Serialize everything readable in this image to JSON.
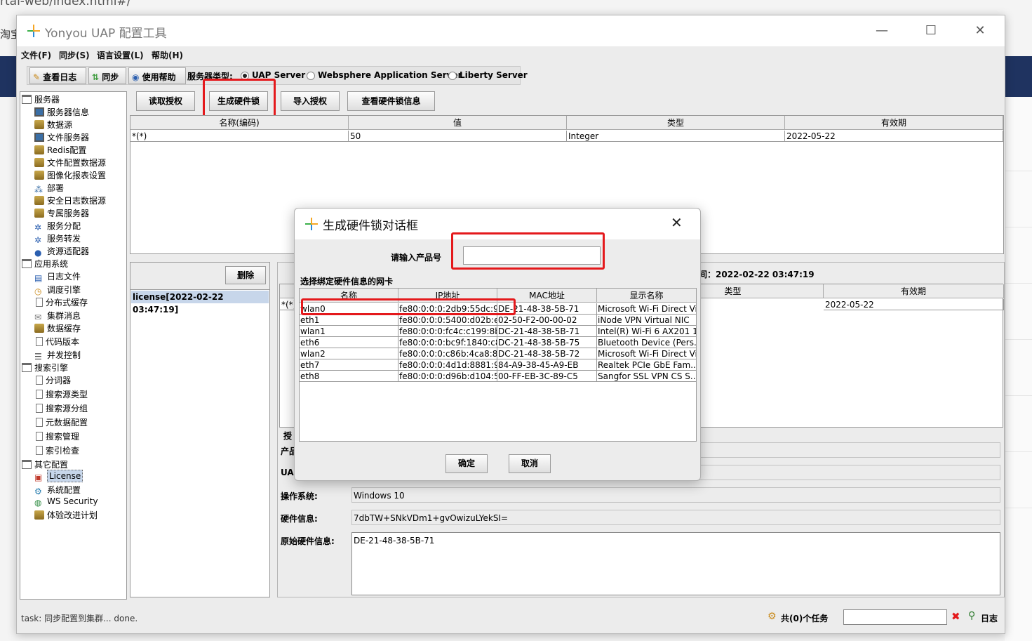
{
  "browser": {
    "url_fragment": "rtal-web/index.html#/",
    "side_text": "淘宝"
  },
  "window": {
    "title": "Yonyou UAP 配置工具",
    "controls": {
      "minimize": "—",
      "maximize": "☐",
      "close": "✕"
    }
  },
  "menu": [
    "文件(F)",
    "同步(S)",
    "语言设置(L)",
    "帮助(H)"
  ],
  "toolbar": {
    "view_log": "查看日志",
    "sync": "同步",
    "help": "使用帮助",
    "server_type_label": "服务器类型:",
    "server_types": [
      "UAP Server",
      "Websphere Application Server",
      "Liberty Server"
    ],
    "selected_server_type": "UAP Server"
  },
  "tree": {
    "groups": [
      {
        "label": "服务器",
        "items": [
          "服务器信息",
          "数据源",
          "文件服务器",
          "Redis配置",
          "文件配置数据源",
          "图像化报表设置",
          "部署",
          "安全日志数据源",
          "专属服务器",
          "服务分配",
          "服务转发",
          "资源适配器"
        ]
      },
      {
        "label": "应用系统",
        "items": [
          "日志文件",
          "调度引擎",
          "分布式缓存",
          "集群消息",
          "数据缓存",
          "代码版本",
          "并发控制"
        ]
      },
      {
        "label": "搜索引擎",
        "items": [
          "分词器",
          "搜索源类型",
          "搜索源分组",
          "元数据配置",
          "搜索管理",
          "索引检查"
        ]
      },
      {
        "label": "其它配置",
        "items": [
          "License",
          "系统配置",
          "WS Security",
          "体验改进计划"
        ]
      }
    ],
    "selected": "License"
  },
  "license_buttons": {
    "read": "读取授权",
    "generate": "生成硬件锁",
    "import": "导入授权",
    "view_hw": "查看硬件锁信息"
  },
  "top_table": {
    "headers": [
      "名称(编码)",
      "值",
      "类型",
      "有效期"
    ],
    "rows": [
      [
        "*(*)",
        "50",
        "Integer",
        "2022-05-22"
      ]
    ]
  },
  "license_list": {
    "delete": "删除",
    "items": [
      "license[2022-02-22 03:47:19]"
    ]
  },
  "detail": {
    "time_text": "间：2022-02-22 03:47:19",
    "headers": [
      "类型",
      "有效期"
    ],
    "row_key": "*(*)",
    "row_expiry": "2022-05-22",
    "auth_label": "授",
    "product_label": "产品",
    "uap_label": "UAI",
    "os_label": "操作系统:",
    "os_value": "Windows 10",
    "hw_label": "硬件信息:",
    "hw_value": "7dbTW+SNkVDm1+gvOwizuLYekSI=",
    "raw_hw_label": "原始硬件信息:",
    "raw_hw_value": "DE-21-48-38-5B-71"
  },
  "dialog": {
    "title": "生成硬件锁对话框",
    "product_label": "请输入产品号",
    "product_value": "",
    "nic_section": "选择绑定硬件信息的网卡",
    "nic_headers": [
      "名称",
      "IP地址",
      "MAC地址",
      "显示名称"
    ],
    "nics": [
      [
        "wlan0",
        "fe80:0:0:0:2db9:55dc:9...",
        "DE-21-48-38-5B-71",
        "Microsoft Wi-Fi Direct Vi..."
      ],
      [
        "eth1",
        "fe80:0:0:0:5400:d02b:e...",
        "02-50-F2-00-00-02",
        "iNode VPN Virtual NIC"
      ],
      [
        "wlan1",
        "fe80:0:0:0:fc4c:c199:8b...",
        "DC-21-48-38-5B-71",
        "Intel(R) Wi-Fi 6 AX201 1..."
      ],
      [
        "eth6",
        "fe80:0:0:0:bc9f:1840:c8...",
        "DC-21-48-38-5B-75",
        "Bluetooth Device (Pers..."
      ],
      [
        "wlan2",
        "fe80:0:0:0:c86b:4ca8:8...",
        "DC-21-48-38-5B-72",
        "Microsoft Wi-Fi Direct Vi..."
      ],
      [
        "eth7",
        "fe80:0:0:0:4d1d:8881:9f...",
        "84-A9-38-45-A9-EB",
        "Realtek PCIe GbE Fam..."
      ],
      [
        "eth8",
        "fe80:0:0:0:d96b:d104:5...",
        "00-FF-EB-3C-89-C5",
        "Sangfor SSL VPN CS S..."
      ]
    ],
    "ok": "确定",
    "cancel": "取消",
    "close": "✕"
  },
  "status": {
    "task": "task: 同步配置到集群... done.",
    "tasks": "共(0)个任务",
    "clear": "✖",
    "log": "日志"
  },
  "colors": {
    "highlight": "#e4191c",
    "selection": "#c7d6ea"
  }
}
